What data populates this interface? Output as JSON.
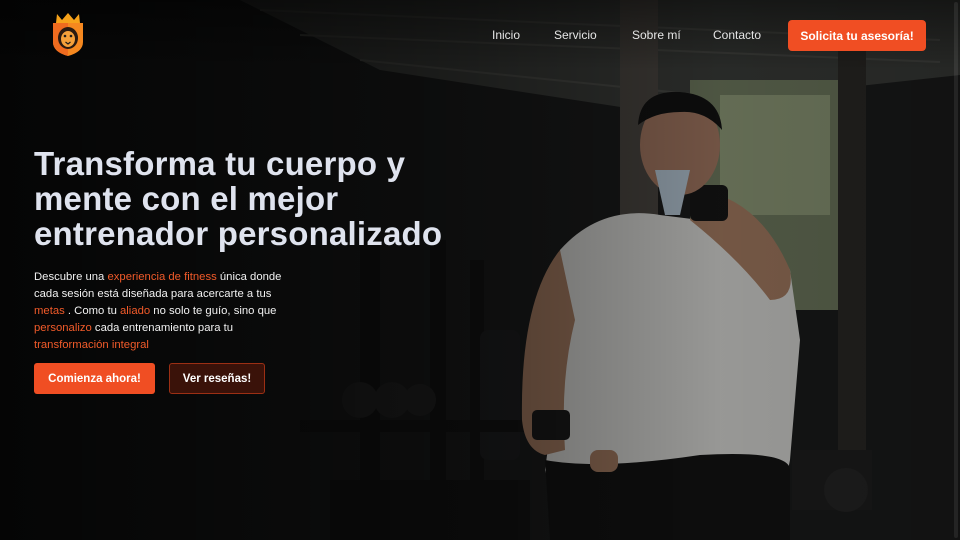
{
  "nav": {
    "links": [
      "Inicio",
      "Servicio",
      "Sobre mí",
      "Contacto"
    ],
    "cta_label": "Solicita tu asesoría!"
  },
  "hero": {
    "title_lines": [
      "Transforma tu cuerpo y",
      "mente con el mejor",
      "entrenador personalizado"
    ],
    "desc": {
      "t1": "Descubre una ",
      "h1": "experiencia de fitness",
      "t2": " única donde cada sesión está diseñada para acercarte a tus ",
      "h2": "metas",
      "t3": " . Como tu ",
      "h3": "aliado",
      "t4": " no solo te guío, sino que ",
      "h4": "personalizo",
      "t5": " cada entrenamiento para tu ",
      "h5": "transformación integral"
    },
    "primary_button": "Comienza ahora!",
    "secondary_button": "Ver reseñas!"
  },
  "colors": {
    "accent": "#f04e23",
    "highlight": "#f25b2a",
    "title": "#dfe3ee"
  },
  "icons": {
    "logo": "lion-crown-shield-icon"
  }
}
